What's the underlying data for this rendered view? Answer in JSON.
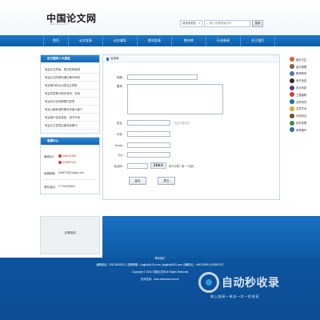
{
  "header": {
    "logo": "中国论文网",
    "logo_sub": "www.lunwen.gz.cn",
    "search_select": "请选择类型",
    "search_placeholder": "输入你要搜索的词",
    "search_button": "搜索"
  },
  "nav": {
    "items": [
      "首页",
      "论文发表",
      "论文辅导",
      "期刊发表",
      "期刊库",
      "行业新闻",
      "关于我们"
    ]
  },
  "sidebar": {
    "articles_title": "论文服务八大保证",
    "articles": [
      "保证论文质量，原创性和新颖",
      "保证论文的顺利通过期刊审查",
      "保证期刊的合法性及正规性",
      "保证发表期刊真实有效，杜绝",
      "保证在约定的期限内发表",
      "保证以最真诚的服务态度为客户",
      "保证客户信息保密，绝不外泄",
      "保证论文发表后能收到期刊"
    ],
    "contact_title": "客服中心",
    "qq_label_1": "编辑QQ：",
    "qq_1": "446130359",
    "qq_2": "615687522",
    "email_label": "投稿邮箱：",
    "email": "635577661@qq.com",
    "phone_label": "联系电话：",
    "phone": "17744035602"
  },
  "main": {
    "title": "信息单",
    "labels": {
      "title": "标题：",
      "content": "要求：",
      "name": "姓名：",
      "phone": "手机：",
      "email": "Email：",
      "qq": "QQ：",
      "captcha": "验证码："
    },
    "name_hint": "* 姓名不能为空",
    "captcha_code": "26b3",
    "captcha_hint": "看不清楚？换一个图片",
    "submit_label": "留言",
    "reset_label": "提交"
  },
  "right_links": {
    "items": [
      {
        "label": "医药卫生",
        "color": "#e8553a"
      },
      {
        "label": "经济管理",
        "color": "#8b5e3c"
      },
      {
        "label": "教育教学",
        "color": "#4a78c2"
      },
      {
        "label": "电子信息",
        "color": "#2b2b2b"
      },
      {
        "label": "农业科技",
        "color": "#5a3a7a"
      },
      {
        "label": "工程建筑",
        "color": "#d43f2f"
      },
      {
        "label": "法学研究",
        "color": "#1f6fb8"
      },
      {
        "label": "文学艺术",
        "color": "#e2a72e"
      },
      {
        "label": "社科综合",
        "color": "#7a4a2a"
      },
      {
        "label": "历史地理",
        "color": "#3d8f4a"
      },
      {
        "label": "体育期刊",
        "color": "#2d6ea8"
      }
    ]
  },
  "graybox": {
    "label": "友情链接"
  },
  "footer": {
    "line1": "联系我们",
    "line2": "编辑电话：028-33939121 | 投稿邮箱：jingjilw@126.com | jingjilw@163.com | 编辑QQ：446130359 | 615687522",
    "line3": "Copyright © 2015 中国论文网 All Rights Reserved",
    "line4": "技术支持：www.newscsw.com.cn"
  },
  "watermark": {
    "title": "自动秒收录",
    "sub": "做上链接一来访一次一秒收录"
  }
}
